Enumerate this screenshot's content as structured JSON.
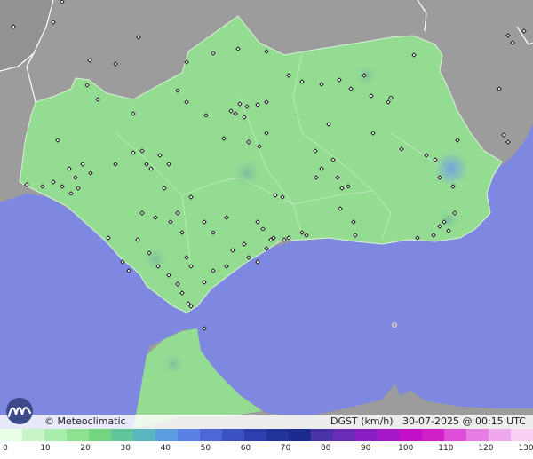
{
  "header": {
    "brand": "© Meteoclimatic",
    "product": "DGST (km/h)",
    "datetime": "30-07-2025 @ 00:15 UTC"
  },
  "legend": {
    "ticks": [
      "0",
      "10",
      "20",
      "30",
      "40",
      "50",
      "60",
      "70",
      "80",
      "90",
      "100",
      "110",
      "120",
      "130"
    ],
    "colors": [
      "#e7ffe7",
      "#c8f5c8",
      "#a9edaa",
      "#8ee28f",
      "#73d57d",
      "#5fc79a",
      "#58b6bf",
      "#5b9be0",
      "#5a82e6",
      "#4d67d6",
      "#3b52c2",
      "#2d3fae",
      "#22339c",
      "#1d2b8e",
      "#4a33a8",
      "#6b2cb8",
      "#8a1fc4",
      "#a517c8",
      "#c010c8",
      "#d01ec9",
      "#df4dd8",
      "#e87de3",
      "#f0a8ec",
      "#f7d0f4"
    ],
    "scale_min": 0,
    "scale_max": 130
  },
  "map": {
    "colors": {
      "sea": "#7f88e0",
      "land_outside": "#9c9c9c",
      "andalusia": "#95dc93",
      "gust_patch": "#7fb4c9",
      "high_gust": "#5f8ff0"
    }
  }
}
